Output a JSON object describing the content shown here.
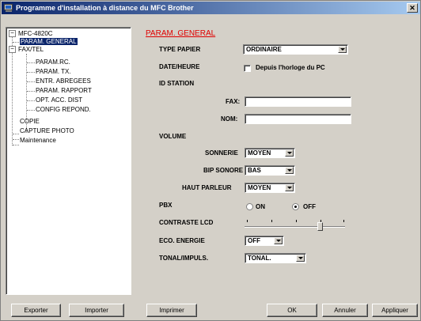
{
  "window": {
    "title": "Programme d'installation à distance du MFC Brother",
    "close_glyph": "✕"
  },
  "tree": {
    "root": "MFC-4820C",
    "root_toggle": "−",
    "faxtel_toggle": "−",
    "items": [
      "PARAM. GENERAL",
      "FAX/TEL",
      "PARAM.RC.",
      "PARAM. TX.",
      "ENTR. ABREGEES",
      "PARAM. RAPPORT",
      "OPT. ACC. DIST",
      "CONFIG REPOND.",
      "COPIE",
      "CAPTURE PHOTO",
      "Maintenance"
    ]
  },
  "panel": {
    "title": "PARAM. GENERAL",
    "type_papier_label": "TYPE PAPIER",
    "type_papier_value": "ORDINAIRE",
    "date_heure_label": "DATE/HEURE",
    "date_heure_checkbox_label": "Depuis l'horloge du PC",
    "date_heure_checked": false,
    "id_station_label": "ID STATION",
    "fax_label": "FAX:",
    "fax_value": "",
    "nom_label": "NOM:",
    "nom_value": "",
    "volume_label": "VOLUME",
    "sonnerie_label": "SONNERIE",
    "sonnerie_value": "MOYEN",
    "bip_label": "BIP SONORE",
    "bip_value": "BAS",
    "hp_label": "HAUT PARLEUR",
    "hp_value": "MOYEN",
    "pbx_label": "PBX",
    "pbx_on_label": "ON",
    "pbx_off_label": "OFF",
    "pbx_selected": "OFF",
    "contraste_label": "CONTRASTE LCD",
    "contraste_level_fraction": 0.75,
    "eco_label": "ECO. ENERGIE",
    "eco_value": "OFF",
    "tonal_label": "TONAL/IMPULS.",
    "tonal_value": "TONAL."
  },
  "buttons": {
    "exporter": "Exporter",
    "importer": "Importer",
    "imprimer": "Imprimer",
    "ok": "OK",
    "annuler": "Annuler",
    "appliquer": "Appliquer"
  }
}
